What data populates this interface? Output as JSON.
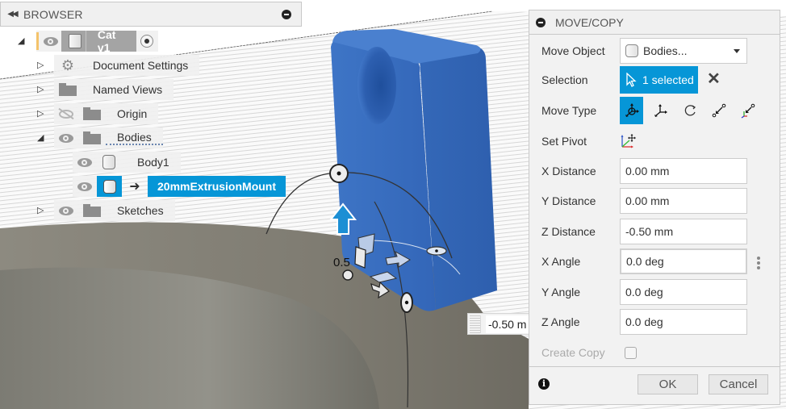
{
  "browser": {
    "title": "BROWSER",
    "collapse_icon": "double-left-arrow-icon",
    "minimize_icon": "minimize-icon",
    "root": {
      "label": "Cat v1",
      "expanded": true,
      "active_marker": "radio-active-icon"
    },
    "items": [
      {
        "label": "Document Settings",
        "icon": "gear-icon",
        "expanded": false,
        "visible": null
      },
      {
        "label": "Named Views",
        "icon": "folder-icon",
        "expanded": false,
        "visible": null
      },
      {
        "label": "Origin",
        "icon": "folder-icon",
        "expanded": false,
        "visible": false
      },
      {
        "label": "Bodies",
        "icon": "folder-icon",
        "expanded": true,
        "visible": true
      },
      {
        "label": "Body1",
        "icon": "body-icon",
        "visible": true
      },
      {
        "label": "20mmExtrusionMount",
        "icon": "body-icon",
        "visible": true,
        "selected": true,
        "link_icon": "arrow-link-icon"
      },
      {
        "label": "Sketches",
        "icon": "folder-icon",
        "expanded": false,
        "visible": true
      }
    ]
  },
  "dialog": {
    "title": "MOVE/COPY",
    "move_object": {
      "label": "Move Object",
      "value": "Bodies..."
    },
    "selection": {
      "label": "Selection",
      "value": "1 selected",
      "clear_icon": "close-icon"
    },
    "move_type": {
      "label": "Move Type",
      "options": [
        "free-move",
        "translate-xyz",
        "rotate",
        "point-to-point",
        "point-to-position"
      ],
      "active": "free-move"
    },
    "set_pivot": {
      "label": "Set Pivot",
      "icon": "pivot-axes-icon"
    },
    "fields": [
      {
        "label": "X Distance",
        "value": "0.00 mm"
      },
      {
        "label": "Y Distance",
        "value": "0.00 mm"
      },
      {
        "label": "Z Distance",
        "value": "-0.50 mm"
      },
      {
        "label": "X Angle",
        "value": "0.0 deg"
      },
      {
        "label": "Y Angle",
        "value": "0.0 deg"
      },
      {
        "label": "Z Angle",
        "value": "0.0 deg"
      }
    ],
    "create_copy": {
      "label": "Create Copy",
      "checked": false
    },
    "ok_label": "OK",
    "cancel_label": "Cancel"
  },
  "viewport": {
    "floating_input_value": "-0.50 m",
    "manipulator_label": "0.5",
    "colors": {
      "body_blue": "#3a6fc0",
      "ground": "#85827a",
      "accent": "#0696d7"
    }
  }
}
